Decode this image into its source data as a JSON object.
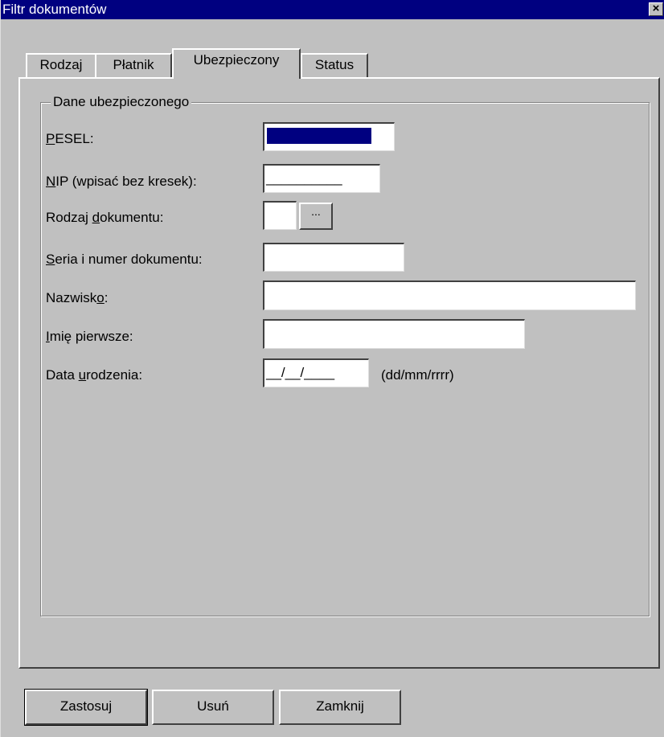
{
  "window": {
    "title": "Filtr dokumentów",
    "close_icon": "close-icon"
  },
  "tabs": [
    {
      "label": "Rodzaj",
      "active": false
    },
    {
      "label": "Płatnik",
      "active": false
    },
    {
      "label": "Ubezpieczony",
      "active": true
    },
    {
      "label": "Status",
      "active": false
    }
  ],
  "group": {
    "title": "Dane ubezpieczonego"
  },
  "fields": {
    "pesel": {
      "label_mnemonic": "P",
      "label_rest": "ESEL:",
      "value": ""
    },
    "nip": {
      "label_mnemonic": "N",
      "label_rest": "IP (wpisać bez kresek):",
      "value": "__________"
    },
    "doc_type": {
      "label_pre": "Rodzaj ",
      "label_mnemonic": "d",
      "label_post": "okumentu:",
      "value": "",
      "browse_label": "..."
    },
    "doc_number": {
      "label_mnemonic": "S",
      "label_rest": "eria i numer dokumentu:",
      "value": ""
    },
    "surname": {
      "label_pre": "Nazwisk",
      "label_mnemonic": "o",
      "label_post": ":",
      "value": ""
    },
    "first_name": {
      "label_mnemonic": "I",
      "label_rest": "mię pierwsze:",
      "value": ""
    },
    "birth_date": {
      "label_pre": "Data ",
      "label_mnemonic": "u",
      "label_post": "rodzenia:",
      "value": "__/__/____",
      "format_hint": "(dd/mm/rrrr)"
    }
  },
  "buttons": {
    "apply": "Zastosuj",
    "delete": "Usuń",
    "close": "Zamknij"
  },
  "colors": {
    "face": "#c0c0c0",
    "titlebar": "#000080",
    "selection": "#000080"
  }
}
